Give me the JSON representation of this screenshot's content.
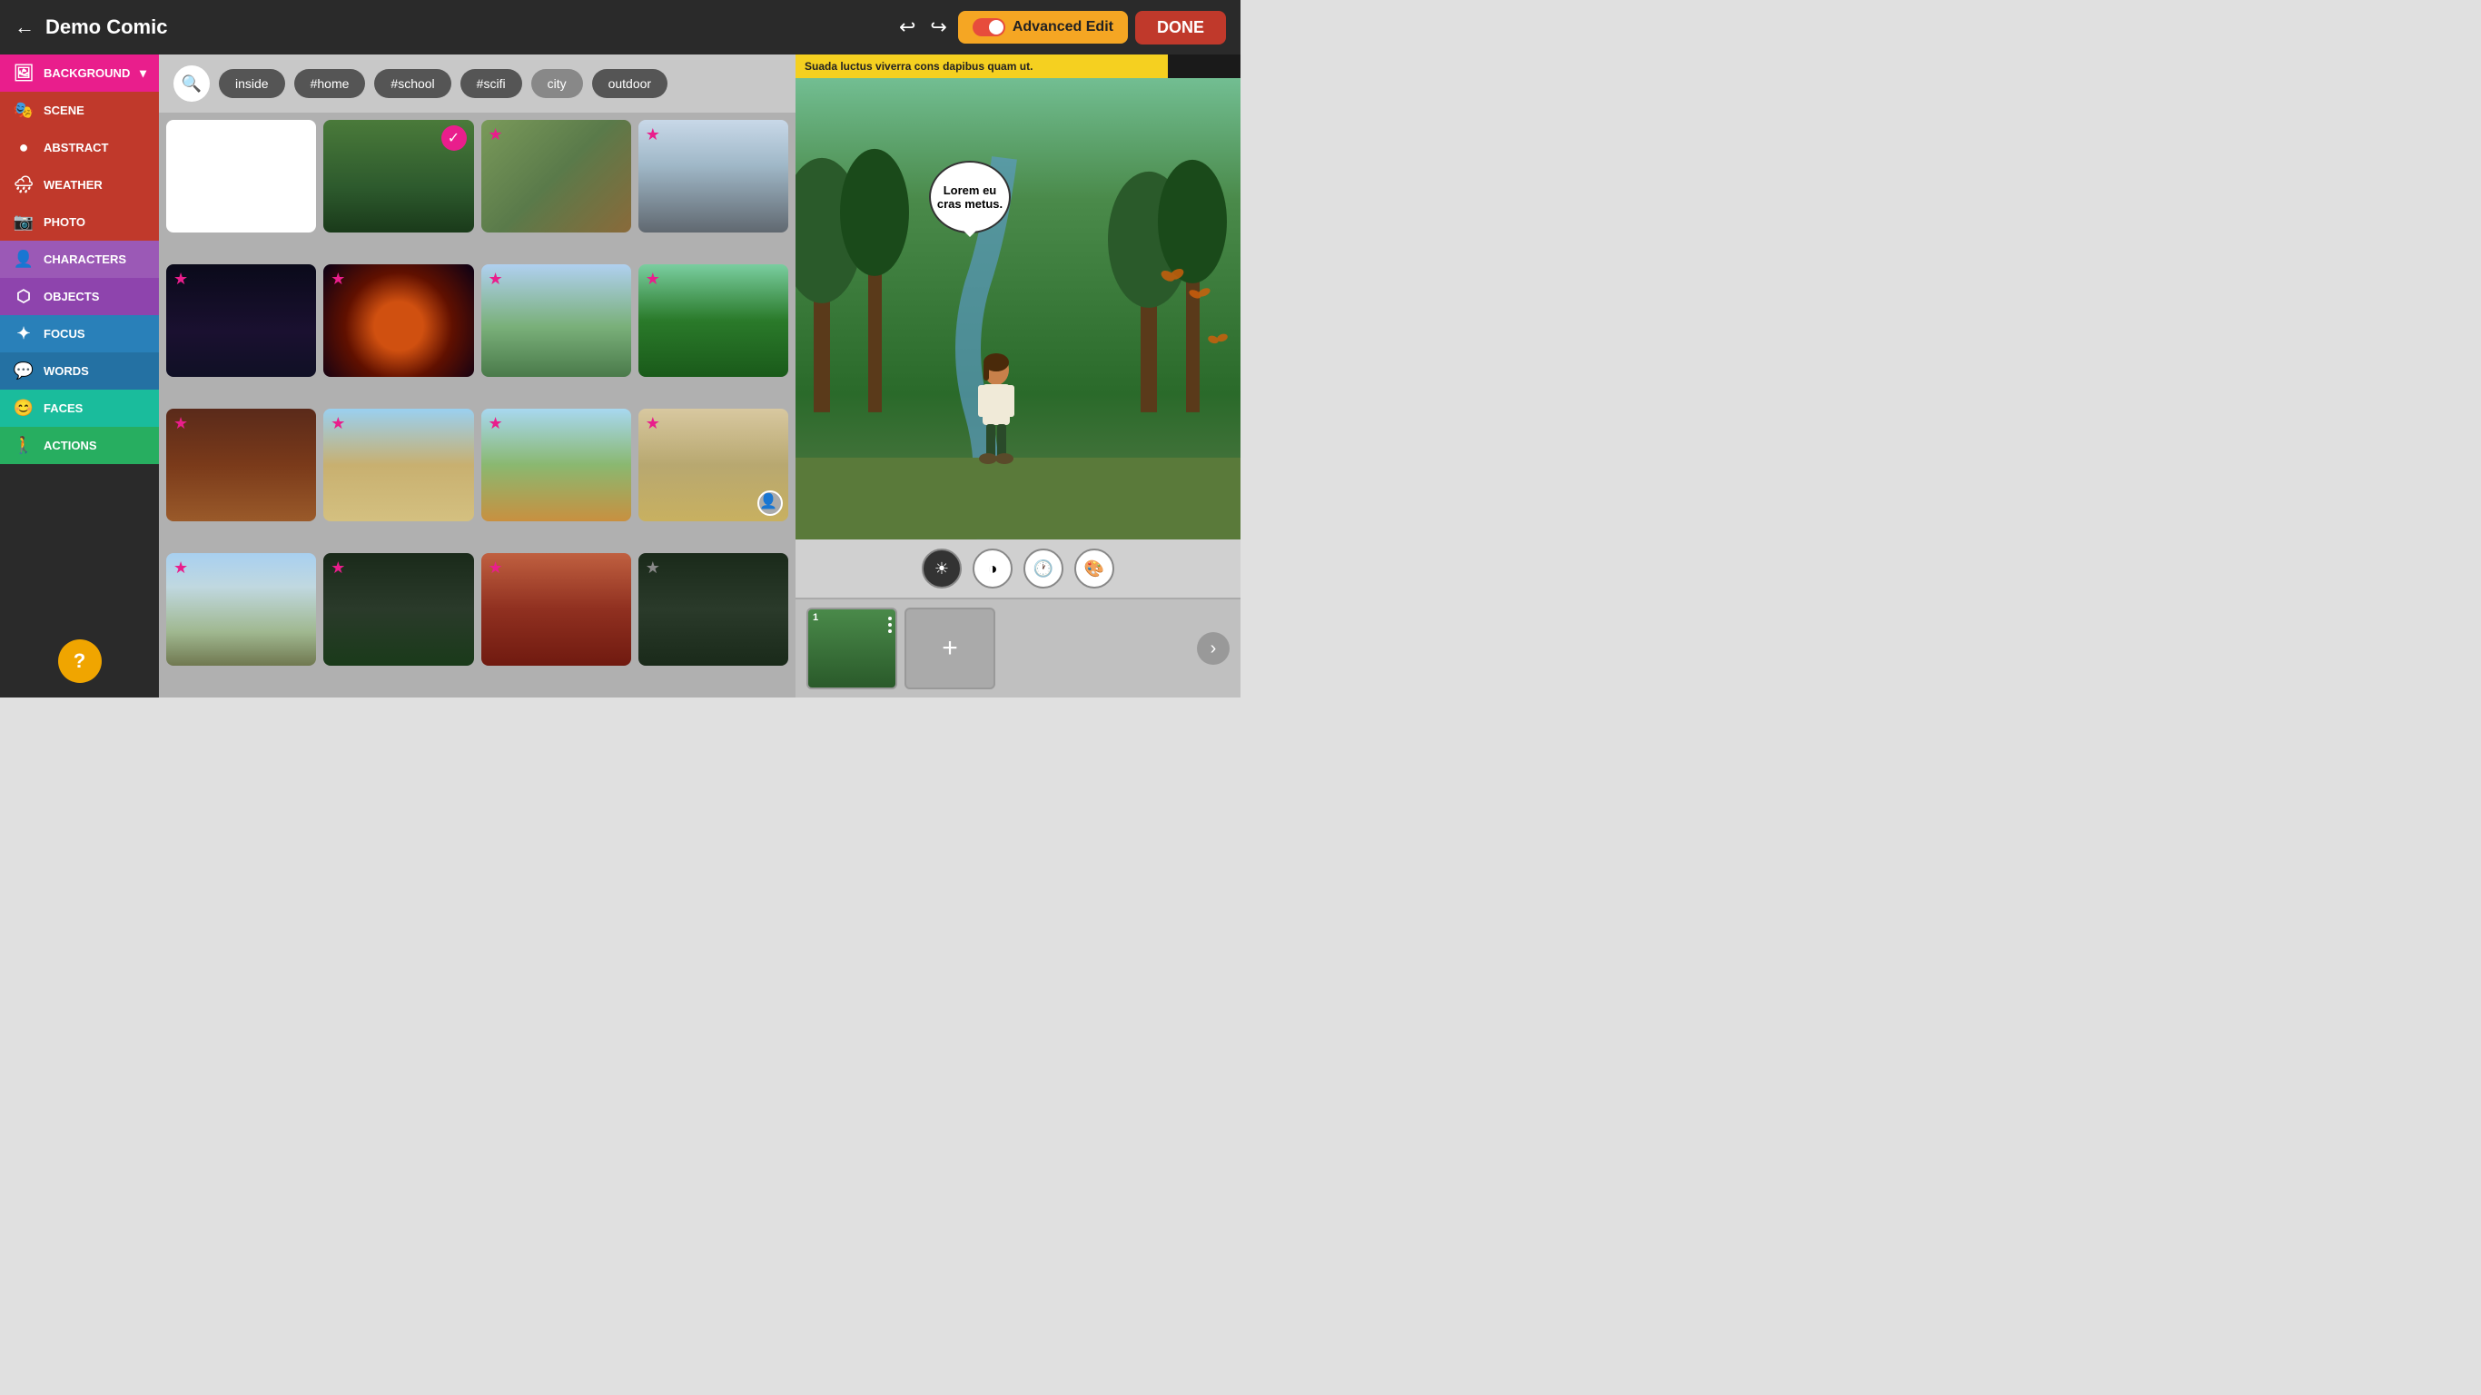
{
  "app": {
    "title": "Demo Comic",
    "back_label": "←",
    "advanced_edit_label": "Advanced Edit",
    "done_label": "DONE"
  },
  "sidebar": {
    "items": [
      {
        "id": "background",
        "label": "BACKGROUND",
        "icon": "🖼",
        "class": "background",
        "active": true
      },
      {
        "id": "scene",
        "label": "SCENE",
        "icon": "🎭",
        "class": "scene"
      },
      {
        "id": "abstract",
        "label": "ABSTRACT",
        "icon": "🔵",
        "class": "abstract"
      },
      {
        "id": "weather",
        "label": "WEATHER",
        "icon": "🌧",
        "class": "weather"
      },
      {
        "id": "photo",
        "label": "PHOTO",
        "icon": "📷",
        "class": "photo"
      },
      {
        "id": "characters",
        "label": "CHARACTERS",
        "icon": "👤",
        "class": "characters"
      },
      {
        "id": "objects",
        "label": "OBJECTS",
        "icon": "⬡",
        "class": "objects"
      },
      {
        "id": "focus",
        "label": "FOCUS",
        "icon": "✦",
        "class": "focus"
      },
      {
        "id": "words",
        "label": "WORDS",
        "icon": "💬",
        "class": "words"
      },
      {
        "id": "faces",
        "label": "FACES",
        "icon": "😊",
        "class": "faces"
      },
      {
        "id": "actions",
        "label": "ACTIONS",
        "icon": "🚶",
        "class": "actions"
      }
    ],
    "help_label": "?"
  },
  "filter": {
    "tags": [
      "inside",
      "#home",
      "#school",
      "#scifi",
      "city",
      "outdoor"
    ]
  },
  "grid": {
    "items": [
      {
        "id": 1,
        "star": "outline",
        "selected": false,
        "bg": "bg-white"
      },
      {
        "id": 2,
        "star": "none",
        "selected": true,
        "bg": "bg-forest"
      },
      {
        "id": 3,
        "star": "filled",
        "selected": false,
        "bg": "bg-futuristic"
      },
      {
        "id": 4,
        "star": "filled",
        "selected": false,
        "bg": "bg-city"
      },
      {
        "id": 5,
        "star": "filled",
        "selected": false,
        "bg": "bg-scifi"
      },
      {
        "id": 6,
        "star": "filled",
        "selected": false,
        "bg": "bg-planet"
      },
      {
        "id": 7,
        "star": "filled",
        "selected": false,
        "bg": "bg-house"
      },
      {
        "id": 8,
        "star": "filled",
        "selected": false,
        "bg": "bg-trees"
      },
      {
        "id": 9,
        "star": "filled",
        "selected": false,
        "bg": "bg-interior"
      },
      {
        "id": 10,
        "star": "filled",
        "selected": false,
        "bg": "bg-temple"
      },
      {
        "id": 11,
        "star": "filled",
        "selected": false,
        "bg": "bg-barn"
      },
      {
        "id": 12,
        "star": "filled",
        "selected": false,
        "bg": "bg-desert",
        "has_avatar": true
      },
      {
        "id": 13,
        "star": "filled",
        "selected": false,
        "bg": "bg-mountains"
      },
      {
        "id": 14,
        "star": "filled",
        "selected": false,
        "bg": "bg-darkforest"
      },
      {
        "id": 15,
        "star": "filled",
        "selected": false,
        "bg": "bg-canyon"
      },
      {
        "id": 16,
        "star": "gray",
        "selected": false,
        "bg": "bg-trees"
      }
    ]
  },
  "preview": {
    "caption": "Suada luctus viverra cons dapibus quam ut.",
    "speech_text": "Lorem eu cras metus.",
    "controls": [
      "brightness",
      "contrast",
      "history",
      "palette"
    ]
  },
  "timeline": {
    "frames": [
      {
        "num": "1",
        "label": "Frame 1"
      }
    ],
    "add_label": "+",
    "next_label": "›"
  }
}
